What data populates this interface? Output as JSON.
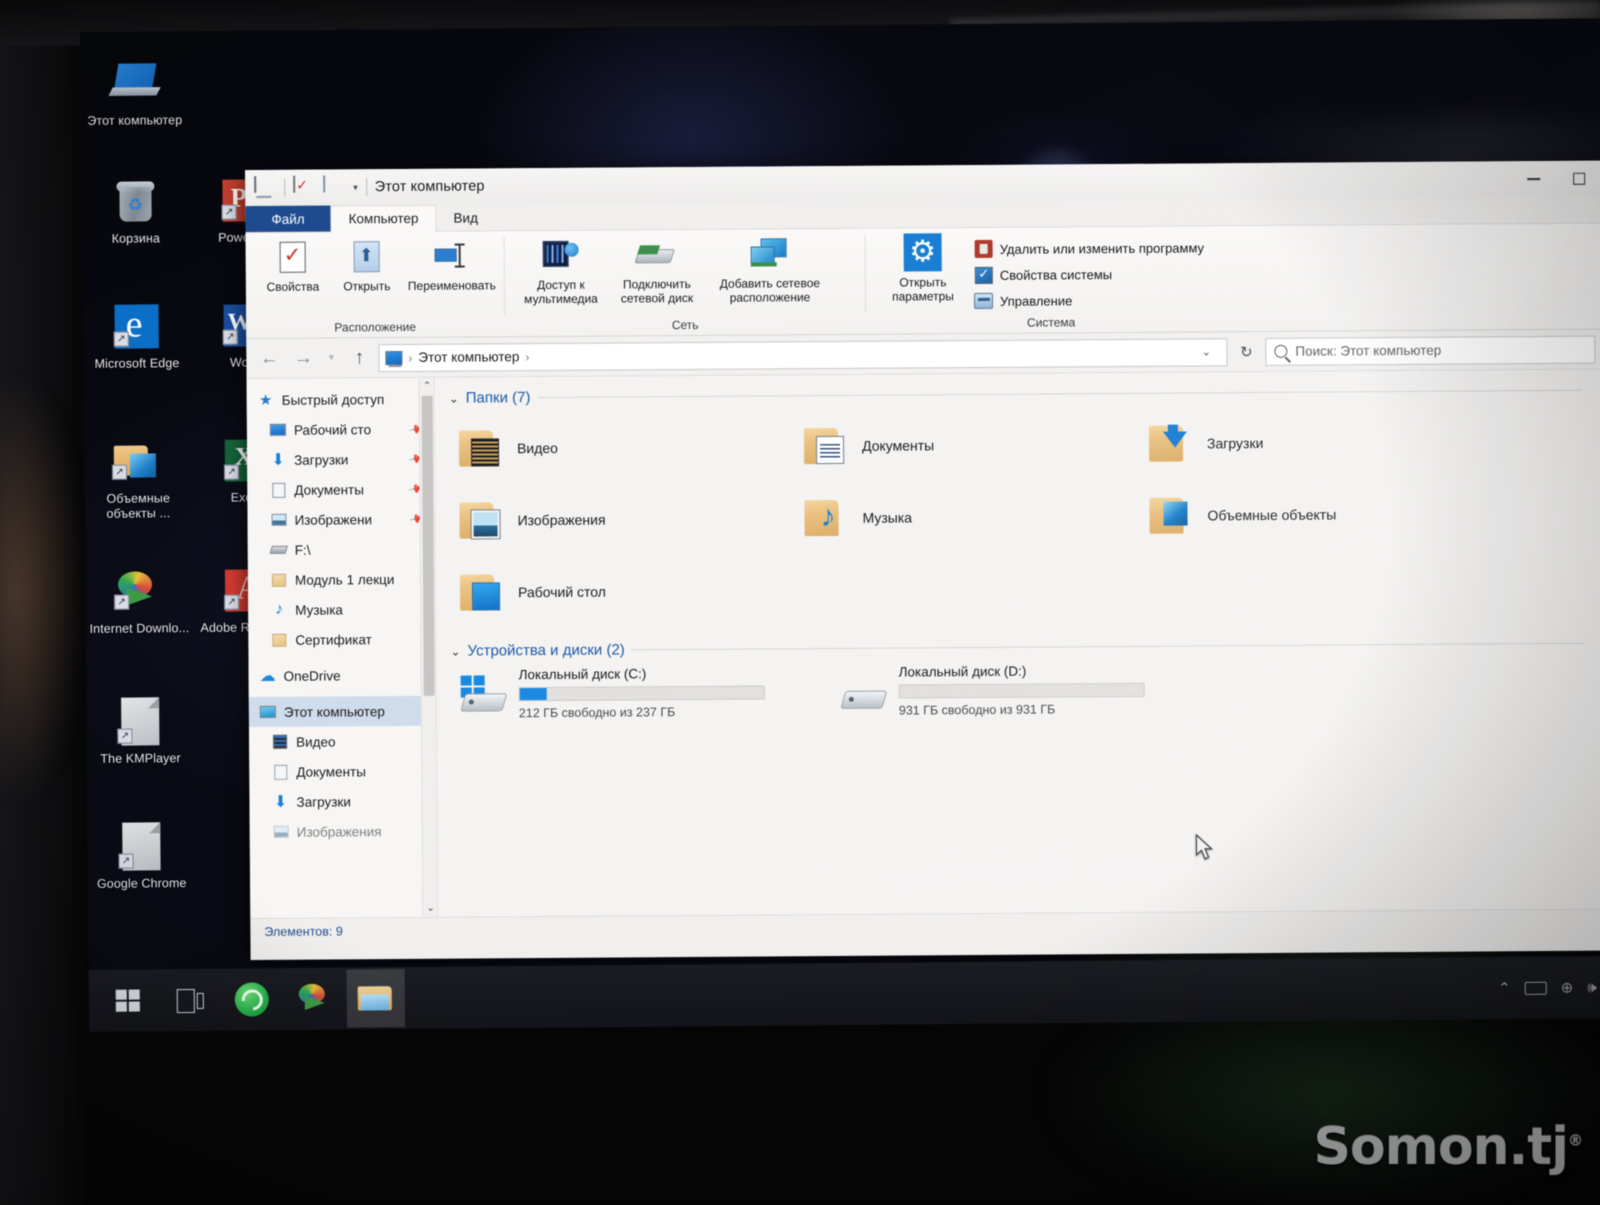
{
  "watermark": {
    "text": "Somon.tj",
    "mark": "®"
  },
  "desktop": {
    "icons": [
      {
        "label": "Этот компьютер",
        "icon": "this-pc-icon"
      },
      {
        "label": "Корзина",
        "icon": "recycle-bin-icon"
      },
      {
        "label": "PowerPo",
        "icon": "powerpoint-icon"
      },
      {
        "label": "Microsoft Edge",
        "icon": "edge-icon"
      },
      {
        "label": "Word",
        "icon": "word-icon"
      },
      {
        "label": "Объемные объекты ...",
        "icon": "3d-objects-folder-icon"
      },
      {
        "label": "Excel",
        "icon": "excel-icon"
      },
      {
        "label": "Internet Downlo...",
        "icon": "internet-download-manager-icon"
      },
      {
        "label": "Adobe Reader X",
        "icon": "adobe-reader-icon"
      },
      {
        "label": "The KMPlayer",
        "icon": "kmplayer-icon"
      },
      {
        "label": "Google Chrome",
        "icon": "chrome-shortcut-icon"
      }
    ]
  },
  "window": {
    "title": "Этот компьютер",
    "quick_access": [
      "this-pc-icon",
      "properties-icon",
      "new-folder-icon",
      "customize-caret-icon"
    ],
    "controls": {
      "minimize": "minimize-button",
      "maximize": "maximize-button"
    }
  },
  "ribbon": {
    "tabs": [
      {
        "label": "Файл",
        "active": false,
        "kind": "file"
      },
      {
        "label": "Компьютер",
        "active": true,
        "kind": "normal"
      },
      {
        "label": "Вид",
        "active": false,
        "kind": "normal"
      }
    ],
    "groups": [
      {
        "title": "Расположение",
        "buttons": [
          {
            "label": "Свойства",
            "icon": "properties-icon"
          },
          {
            "label": "Открыть",
            "icon": "open-icon"
          },
          {
            "label": "Переименовать",
            "icon": "rename-icon"
          }
        ]
      },
      {
        "title": "Сеть",
        "buttons": [
          {
            "label": "Доступ к мультимедиа",
            "icon": "media-streaming-icon",
            "caret": "▾"
          },
          {
            "label": "Подключить сетевой диск",
            "icon": "map-network-drive-icon",
            "caret": "▾"
          },
          {
            "label": "Добавить сетевое расположение",
            "icon": "add-network-location-icon",
            "caret": ""
          }
        ]
      },
      {
        "title": "Система",
        "big_button": {
          "label": "Открыть параметры",
          "icon": "settings-gear-icon"
        },
        "small_buttons": [
          {
            "label": "Удалить или изменить программу",
            "icon": "uninstall-program-icon"
          },
          {
            "label": "Свойства системы",
            "icon": "system-properties-icon"
          },
          {
            "label": "Управление",
            "icon": "manage-computer-icon"
          }
        ]
      }
    ]
  },
  "addressbar": {
    "back": "back-arrow-icon",
    "forward": "forward-arrow-icon",
    "recent": "recent-locations-caret-icon",
    "up": "up-arrow-icon",
    "crumb_icon": "this-pc-icon",
    "crumb": "Этот компьютер",
    "sep1": "›",
    "sep2": "›",
    "dropdown": "⌄",
    "refresh": "↻",
    "search_placeholder": "Поиск: Этот компьютер"
  },
  "navpane": {
    "items": [
      {
        "label": "Быстрый доступ",
        "icon": "quick-access-star-icon",
        "indent": "root",
        "pinned": false,
        "selected": false
      },
      {
        "label": "Рабочий сто",
        "icon": "desktop-icon",
        "indent": "child",
        "pinned": true,
        "selected": false
      },
      {
        "label": "Загрузки",
        "icon": "downloads-icon",
        "indent": "child",
        "pinned": true,
        "selected": false
      },
      {
        "label": "Документы",
        "icon": "documents-icon",
        "indent": "child",
        "pinned": true,
        "selected": false
      },
      {
        "label": "Изображени",
        "icon": "pictures-icon",
        "indent": "child",
        "pinned": true,
        "selected": false
      },
      {
        "label": "F:\\",
        "icon": "drive-icon",
        "indent": "child",
        "pinned": false,
        "selected": false
      },
      {
        "label": "Модуль 1 лекци",
        "icon": "folder-icon",
        "indent": "child",
        "pinned": false,
        "selected": false
      },
      {
        "label": "Музыка",
        "icon": "music-icon",
        "indent": "child",
        "pinned": false,
        "selected": false
      },
      {
        "label": "Сертификат",
        "icon": "folder-icon",
        "indent": "child",
        "pinned": false,
        "selected": false
      },
      {
        "label": "OneDrive",
        "icon": "onedrive-cloud-icon",
        "indent": "root",
        "pinned": false,
        "selected": false
      },
      {
        "label": "Этот компьютер",
        "icon": "this-pc-icon",
        "indent": "root",
        "pinned": false,
        "selected": true
      },
      {
        "label": "Видео",
        "icon": "videos-icon",
        "indent": "child",
        "pinned": false,
        "selected": false
      },
      {
        "label": "Документы",
        "icon": "documents-icon",
        "indent": "child",
        "pinned": false,
        "selected": false
      },
      {
        "label": "Загрузки",
        "icon": "downloads-icon",
        "indent": "child",
        "pinned": false,
        "selected": false
      },
      {
        "label": "Изображения",
        "icon": "pictures-icon",
        "indent": "child",
        "pinned": false,
        "selected": false
      }
    ]
  },
  "content": {
    "folders_header": "Папки (7)",
    "folders": [
      {
        "label": "Видео",
        "icon": "videos-folder-icon"
      },
      {
        "label": "Документы",
        "icon": "documents-folder-icon"
      },
      {
        "label": "Загрузки",
        "icon": "downloads-folder-icon"
      },
      {
        "label": "Изображения",
        "icon": "pictures-folder-icon"
      },
      {
        "label": "Музыка",
        "icon": "music-folder-icon"
      },
      {
        "label": "Объемные объекты",
        "icon": "3d-objects-folder-icon"
      },
      {
        "label": "Рабочий стол",
        "icon": "desktop-folder-icon"
      }
    ],
    "devices_header": "Устройства и диски (2)",
    "drives": [
      {
        "name": "Локальный диск (C:)",
        "free_text": "212 ГБ свободно из 237 ГБ",
        "used_percent": 11,
        "system": true
      },
      {
        "name": "Локальный диск (D:)",
        "free_text": "931 ГБ свободно из 931 ГБ",
        "used_percent": 0,
        "system": false
      }
    ]
  },
  "statusbar": {
    "text": "Элементов: 9"
  },
  "taskbar": {
    "buttons": [
      {
        "name": "start-button",
        "icon": "windows-logo-icon",
        "active": false
      },
      {
        "name": "task-view-button",
        "icon": "task-view-icon",
        "active": false
      },
      {
        "name": "whatsapp-button",
        "icon": "whatsapp-icon",
        "active": false
      },
      {
        "name": "idm-button",
        "icon": "internet-download-manager-icon",
        "active": false
      },
      {
        "name": "file-explorer-button",
        "icon": "file-explorer-icon",
        "active": true
      }
    ],
    "tray": [
      {
        "icon": "show-hidden-icons-caret",
        "glyph": "⌃"
      },
      {
        "icon": "keyboard-layout-icon",
        "glyph": ""
      },
      {
        "icon": "network-icon",
        "glyph": "⊕"
      },
      {
        "icon": "volume-icon",
        "glyph": "🕪"
      }
    ]
  },
  "accent": {
    "link_blue": "#1e5aa8",
    "progress_blue": "#1b8ae0",
    "file_tab": "#1e4b8f"
  }
}
